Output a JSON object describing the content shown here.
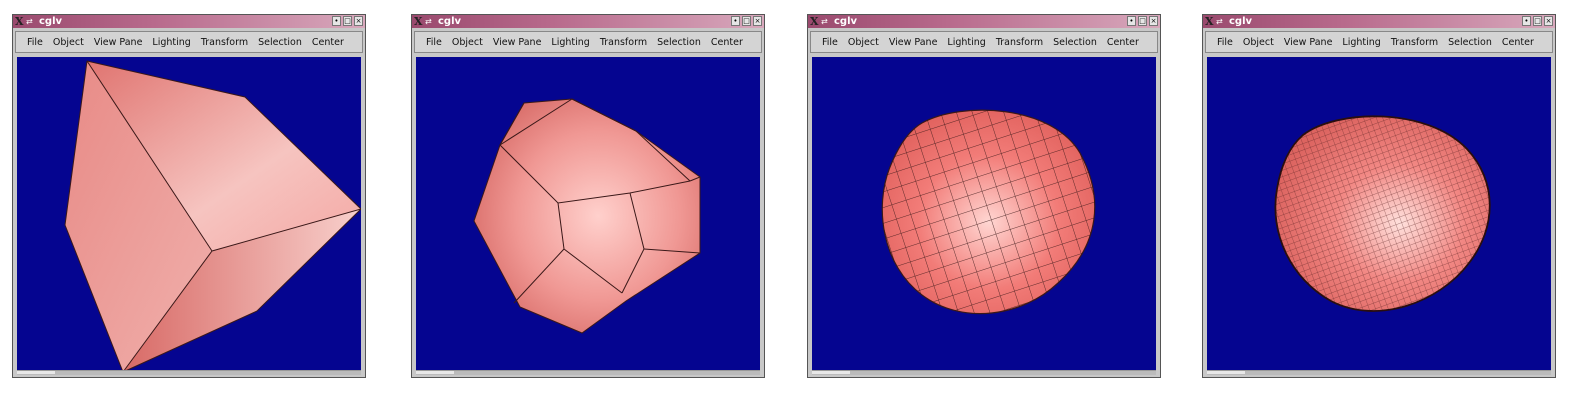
{
  "windows": [
    {
      "title": "cglv",
      "menu": [
        "File",
        "Object",
        "View Pane",
        "Lighting",
        "Transform",
        "Selection",
        "Center"
      ],
      "object": "coarse polyhedron"
    },
    {
      "title": "cglv",
      "menu": [
        "File",
        "Object",
        "View Pane",
        "Lighting",
        "Transform",
        "Selection",
        "Center"
      ],
      "object": "subdivided polyhedron"
    },
    {
      "title": "cglv",
      "menu": [
        "File",
        "Object",
        "View Pane",
        "Lighting",
        "Transform",
        "Selection",
        "Center"
      ],
      "object": "smooth quad mesh"
    },
    {
      "title": "cglv",
      "menu": [
        "File",
        "Object",
        "View Pane",
        "Lighting",
        "Transform",
        "Selection",
        "Center"
      ],
      "object": "dense quad mesh"
    }
  ],
  "window_buttons": [
    "•",
    "□",
    "×"
  ],
  "colors": {
    "viewport": "#050590",
    "surface": "#f07a78",
    "highlight": "#ffd2d0",
    "titlebar": "#b86a8c"
  }
}
